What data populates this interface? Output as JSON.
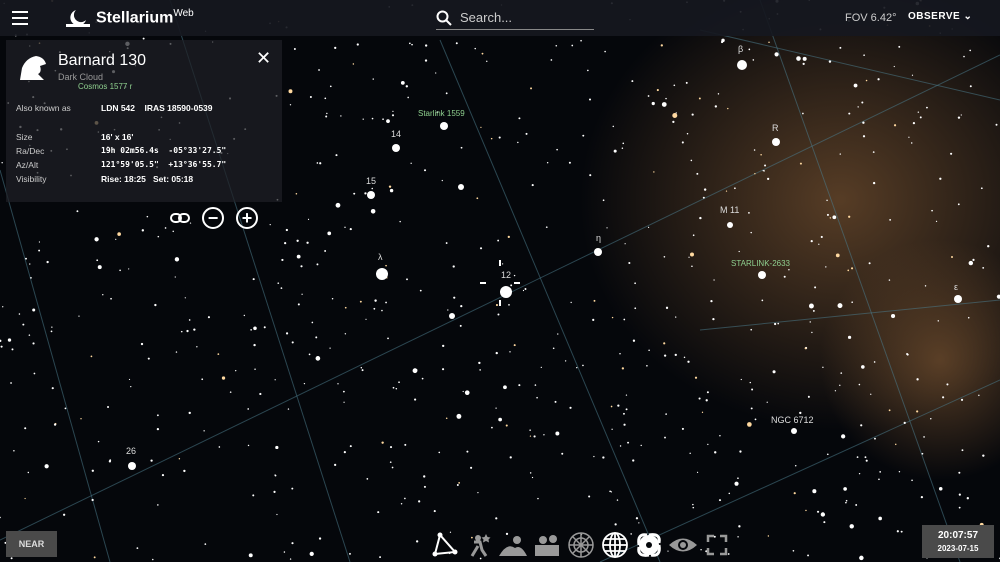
{
  "header": {
    "app_name": "Stellarium",
    "app_suffix": "Web",
    "search_placeholder": "Search...",
    "fov": "FOV 6.42°",
    "observe": "OBSERVE"
  },
  "selection": {
    "title": "Barnard 130",
    "type": "Dark Cloud",
    "rows": [
      {
        "label": "Also known as",
        "value": "LDN 542    IRAS 18590-0539",
        "mono": false
      },
      {
        "label": "Size",
        "value": "16' x 16'",
        "mono": false
      },
      {
        "label": "Ra/Dec",
        "value": "19h 02m56.4s  -05°33'27.5\"",
        "mono": true
      },
      {
        "label": "Az/Alt",
        "value": "121°59'05.5\"  +13°36'55.7\"",
        "mono": true
      },
      {
        "label": "Visibility",
        "value": "Rise: 18:25   Set: 05:18",
        "mono": false
      }
    ]
  },
  "sky_labels": [
    {
      "text": "Cosmos 1577 r",
      "kind": "sat"
    },
    {
      "text": "Starlink 1559",
      "kind": "sat"
    },
    {
      "text": "STARLINK-2633",
      "kind": "sat"
    },
    {
      "text": "14",
      "kind": "star"
    },
    {
      "text": "15",
      "kind": "star"
    },
    {
      "text": "λ",
      "kind": "star"
    },
    {
      "text": "12",
      "kind": "star"
    },
    {
      "text": "η",
      "kind": "star"
    },
    {
      "text": "β",
      "kind": "star"
    },
    {
      "text": "R",
      "kind": "star"
    },
    {
      "text": "M 11",
      "kind": "dso"
    },
    {
      "text": "ε",
      "kind": "star"
    },
    {
      "text": "NGC 6712",
      "kind": "dso"
    },
    {
      "text": "26",
      "kind": "star"
    }
  ],
  "bottom": {
    "near": "NEAR",
    "time": "20:07:57",
    "date": "2023-07-15"
  },
  "colors": {
    "bar": "#16181f",
    "button": "#4a4a4a",
    "satellite": "#8fd08f",
    "milkyway": "#6b4a2c"
  }
}
